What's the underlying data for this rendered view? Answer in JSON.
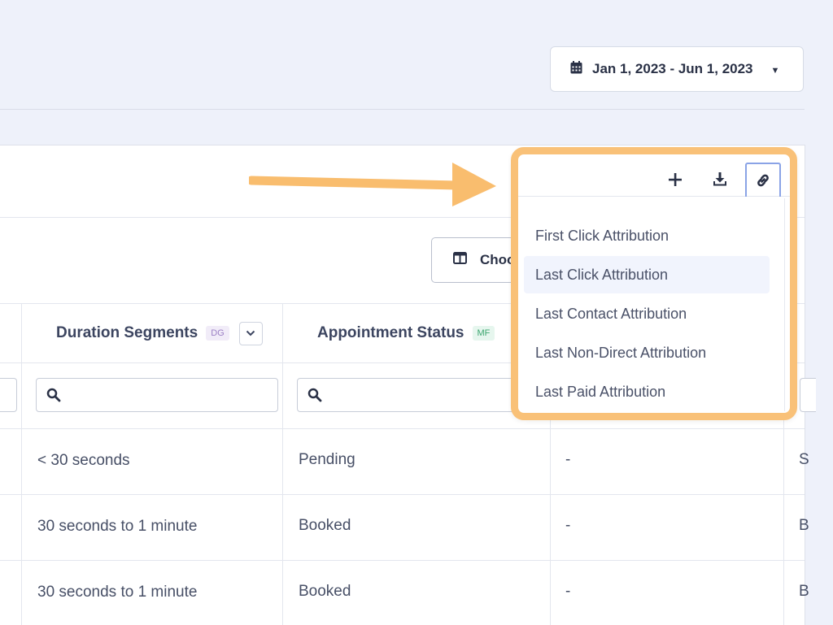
{
  "date_range": {
    "label": "Jan 1, 2023 - Jun 1, 2023"
  },
  "toolbar": {
    "choose_label": "Choo"
  },
  "columns": [
    {
      "label": "Duration Segments",
      "tag": "DG"
    },
    {
      "label": "Appointment Status",
      "tag": "MF"
    }
  ],
  "rows": [
    {
      "duration": "< 30 seconds",
      "status": "Pending",
      "col3": "-",
      "col4": "S"
    },
    {
      "duration": "30 seconds to 1 minute",
      "status": "Booked",
      "col3": "-",
      "col4": "B"
    },
    {
      "duration": "30 seconds to 1 minute",
      "status": "Booked",
      "col3": "-",
      "col4": "B"
    }
  ],
  "popup": {
    "menu_items": [
      "First Click Attribution",
      "Last Click Attribution",
      "Last Contact Attribution",
      "Last Non-Direct Attribution",
      "Last Paid Attribution"
    ]
  },
  "colors": {
    "highlight_border": "#f9c178",
    "arrow": "#f9bd6e",
    "background": "#eef1fa"
  }
}
